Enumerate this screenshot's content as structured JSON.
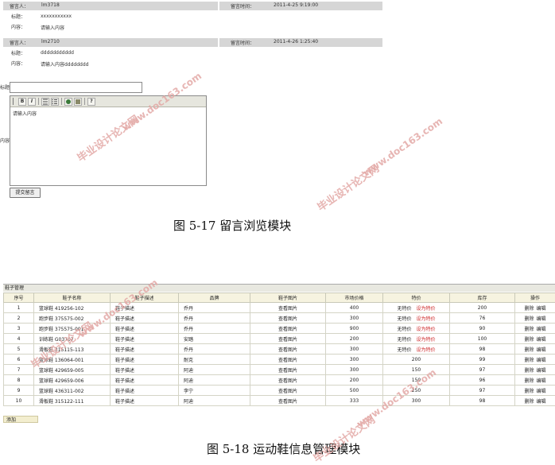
{
  "messages": [
    {
      "author_label": "留言人：",
      "author": "lm3718",
      "time_label": "留言时间：",
      "time": "2011-4-25 9:19:00",
      "title_label": "标题：",
      "title": "xxxxxxxxxxx",
      "content_label": "内容：",
      "content": "请输入内容"
    },
    {
      "author_label": "留言人：",
      "author": "lm2710",
      "time_label": "留言时间：",
      "time": "2011-4-26 1:25:40",
      "title_label": "标题：",
      "title": "ddddddddddd",
      "content_label": "内容：",
      "content": "请输入内容dddddddd"
    }
  ],
  "form": {
    "title_label": "标题",
    "content_label": "内容",
    "content_placeholder": "请输入内容",
    "submit_label": "提交留言"
  },
  "toolbar_icons": [
    "bold-icon",
    "italic-icon",
    "ordered-list-icon",
    "unordered-list-icon",
    "insert-image-icon",
    "insert-media-icon",
    "help-icon"
  ],
  "toolbar_glyphs": {
    "bold": "B",
    "italic": "I",
    "help": "?"
  },
  "caption1": "图 5-17   留言浏览模块",
  "shoe_table": {
    "title": "鞋子管理",
    "headers": [
      "序号",
      "鞋子名称",
      "鞋子描述",
      "品牌",
      "鞋子图片",
      "市场价格",
      "特价",
      "库存",
      "操作"
    ],
    "rows": [
      {
        "no": "1",
        "name": "篮球鞋  419256-102",
        "desc": "鞋子描述",
        "brand": "乔丹",
        "image": "查看图片",
        "price": "400",
        "special": "无特价",
        "special_link": "设为特价",
        "stock": "200",
        "delete": "删除",
        "edit": "编辑"
      },
      {
        "no": "2",
        "name": "跑步鞋  375575-002",
        "desc": "鞋子描述",
        "brand": "乔丹",
        "image": "查看图片",
        "price": "300",
        "special": "无特价",
        "special_link": "设为特价",
        "stock": "76",
        "delete": "删除",
        "edit": "编辑"
      },
      {
        "no": "3",
        "name": "跑步鞋  375575-001",
        "desc": "鞋子描述",
        "brand": "乔丹",
        "image": "查看图片",
        "price": "900",
        "special": "无特价",
        "special_link": "设为特价",
        "stock": "90",
        "delete": "删除",
        "edit": "编辑"
      },
      {
        "no": "4",
        "name": "训练鞋  G03707",
        "desc": "鞋子描述",
        "brand": "安踏",
        "image": "查看图片",
        "price": "200",
        "special": "无特价",
        "special_link": "设为特价",
        "stock": "100",
        "delete": "删除",
        "edit": "编辑"
      },
      {
        "no": "5",
        "name": "滑板鞋  315115-113",
        "desc": "鞋子描述",
        "brand": "乔丹",
        "image": "查看图片",
        "price": "300",
        "special": "无特价",
        "special_link": "设为特价",
        "stock": "98",
        "delete": "删除",
        "edit": "编辑"
      },
      {
        "no": "6",
        "name": "篮球鞋  136064-001",
        "desc": "鞋子描述",
        "brand": "耐克",
        "image": "查看图片",
        "price": "300",
        "special": "200",
        "special_link": "",
        "stock": "99",
        "delete": "删除",
        "edit": "编辑"
      },
      {
        "no": "7",
        "name": "篮球鞋  429659-005",
        "desc": "鞋子描述",
        "brand": "阿迪",
        "image": "查看图片",
        "price": "300",
        "special": "150",
        "special_link": "",
        "stock": "97",
        "delete": "删除",
        "edit": "编辑"
      },
      {
        "no": "8",
        "name": "篮球鞋  429659-006",
        "desc": "鞋子描述",
        "brand": "阿迪",
        "image": "查看图片",
        "price": "200",
        "special": "150",
        "special_link": "",
        "stock": "96",
        "delete": "删除",
        "edit": "编辑"
      },
      {
        "no": "9",
        "name": "篮球鞋  436311-002",
        "desc": "鞋子描述",
        "brand": "李宁",
        "image": "查看图片",
        "price": "500",
        "special": "250",
        "special_link": "",
        "stock": "97",
        "delete": "删除",
        "edit": "编辑"
      },
      {
        "no": "10",
        "name": "滑板鞋  315122-111",
        "desc": "鞋子描述",
        "brand": "阿迪",
        "image": "查看图片",
        "price": "333",
        "special": "300",
        "special_link": "",
        "stock": "98",
        "delete": "删除",
        "edit": "编辑"
      }
    ],
    "add_label": "添加"
  },
  "caption2": "图 5-18   运动鞋信息管理模块",
  "watermarks": [
    "毕业设计论文网",
    "www.doc163.com"
  ],
  "colors": {
    "watermark": "#e3a9a6",
    "special_link": "#cc2222",
    "header_bg": "#f6f3e0",
    "bar_bg": "#d6d6d6"
  }
}
